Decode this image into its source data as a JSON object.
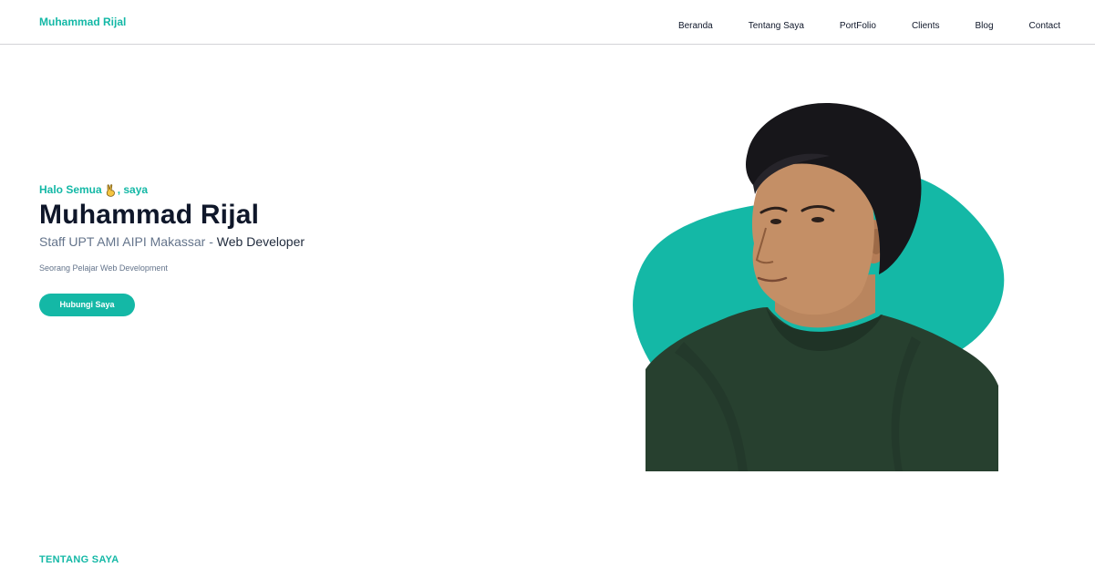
{
  "navbar": {
    "brand": "Muhammad Rijal",
    "items": [
      {
        "label": "Beranda"
      },
      {
        "label": "Tentang Saya"
      },
      {
        "label": "PortFolio"
      },
      {
        "label": "Clients"
      },
      {
        "label": "Blog"
      },
      {
        "label": "Contact"
      }
    ]
  },
  "hero": {
    "greeting_prefix": "Halo Semua",
    "greeting_suffix": ", saya",
    "wave_icon": "victory-hand-icon",
    "name": "Muhammad Rijal",
    "role_main": "Staff UPT AMI AIPI Makassar - ",
    "role_strong": "Web Developer",
    "description": "Seorang Pelajar Web Development",
    "cta_label": "Hubungi Saya",
    "photo_icon": "profile-photo",
    "blob_color": "#14b8a6"
  },
  "about": {
    "section_label": "TENTANG SAYA"
  },
  "colors": {
    "accent": "#14b8a6",
    "text_dark": "#0f172a",
    "text_muted": "#64748b",
    "shirt": "#27402f"
  }
}
